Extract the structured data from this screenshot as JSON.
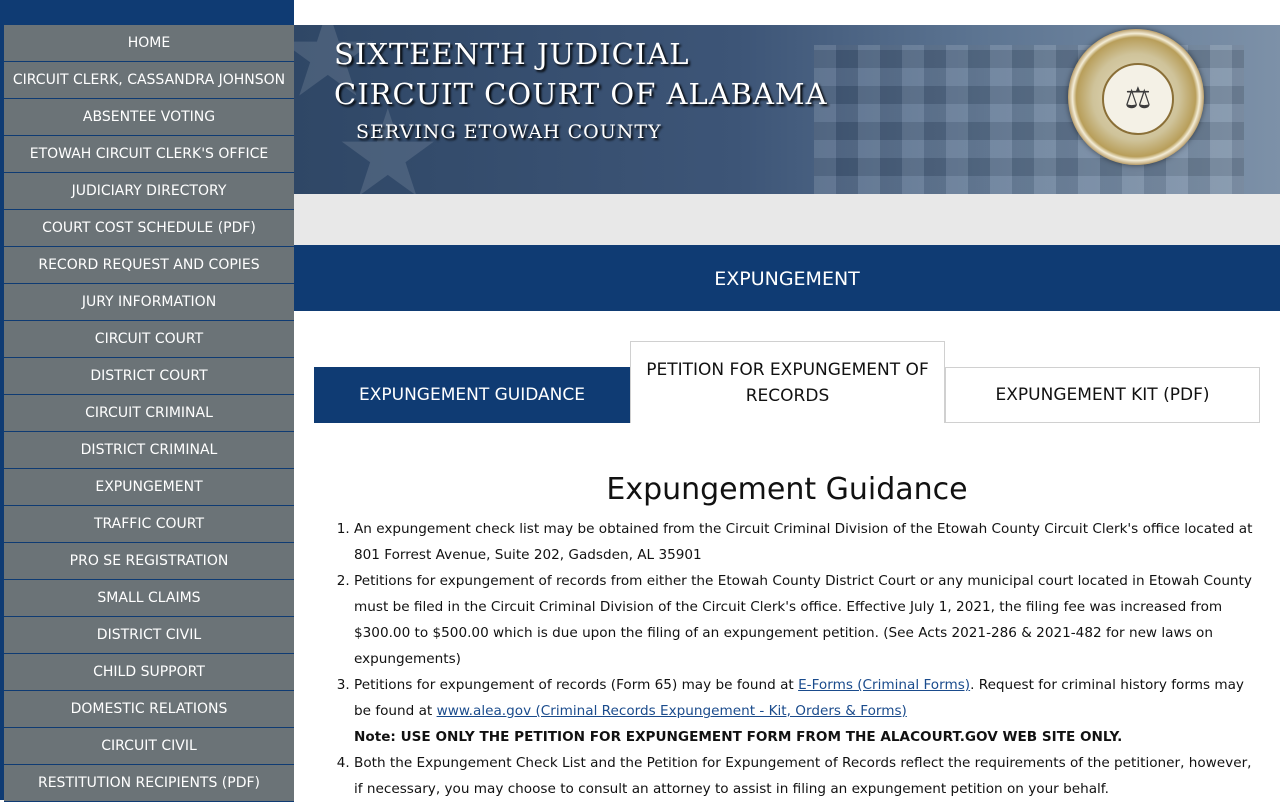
{
  "sidebar": {
    "items": [
      "HOME",
      "CIRCUIT CLERK, CASSANDRA JOHNSON",
      "ABSENTEE VOTING",
      "ETOWAH CIRCUIT CLERK'S OFFICE",
      "JUDICIARY DIRECTORY",
      "COURT COST SCHEDULE (PDF)",
      "RECORD REQUEST AND COPIES",
      "JURY INFORMATION",
      "CIRCUIT COURT",
      "DISTRICT COURT",
      "CIRCUIT CRIMINAL",
      "DISTRICT CRIMINAL",
      "EXPUNGEMENT",
      "TRAFFIC COURT",
      "PRO SE REGISTRATION",
      "SMALL CLAIMS",
      "DISTRICT CIVIL",
      "CHILD SUPPORT",
      "DOMESTIC RELATIONS",
      "CIRCUIT CIVIL",
      "RESTITUTION RECIPIENTS (PDF)"
    ]
  },
  "banner": {
    "line1": "SIXTEENTH JUDICIAL",
    "line2": "CIRCUIT COURT OF ALABAMA",
    "line3": "SERVING ETOWAH COUNTY",
    "seal_icon": "unified-judicial-system-seal"
  },
  "page_title": "EXPUNGEMENT",
  "tabs": {
    "guidance": "EXPUNGEMENT GUIDANCE",
    "petition": "PETITION FOR EXPUNGEMENT OF RECORDS",
    "kit": "EXPUNGEMENT KIT (PDF)"
  },
  "content": {
    "heading": "Expungement Guidance",
    "item1": "An expungement check list may be obtained from the Circuit Criminal Division of the Etowah County Circuit Clerk's office located at 801 Forrest Avenue, Suite 202, Gadsden, AL 35901",
    "item2": "Petitions for expungement of records from either the Etowah County District Court or any municipal court located in Etowah County must be filed in the Circuit Criminal Division of the Circuit Clerk's office.  Effective July 1, 2021, the filing fee was increased from $300.00 to $500.00 which is due upon the filing of an expungement petition. (See Acts 2021-286 & 2021-482 for new laws on expungements)",
    "item3_part1": "Petitions for expungement of records (Form 65) may be found at ",
    "item3_link1": "E-Forms (Criminal Forms)",
    "item3_part2": ". Request for criminal history forms may be found at ",
    "item3_link2": "www.alea.gov (Criminal Records Expungement - Kit, Orders & Forms)",
    "item3_note": "Note: USE ONLY THE PETITION FOR EXPUNGEMENT FORM FROM THE ALACOURT.GOV WEB SITE ONLY.",
    "item4": "Both the Expungement Check List and the Petition for Expungement of Records reflect the requirements of the petitioner, however, if necessary, you may choose to consult an attorney to assist in filing an expungement petition on your behalf."
  },
  "colors": {
    "navy": "#0f3b73",
    "sidebar_item": "#6b7377",
    "strip": "#e8e8e8"
  }
}
